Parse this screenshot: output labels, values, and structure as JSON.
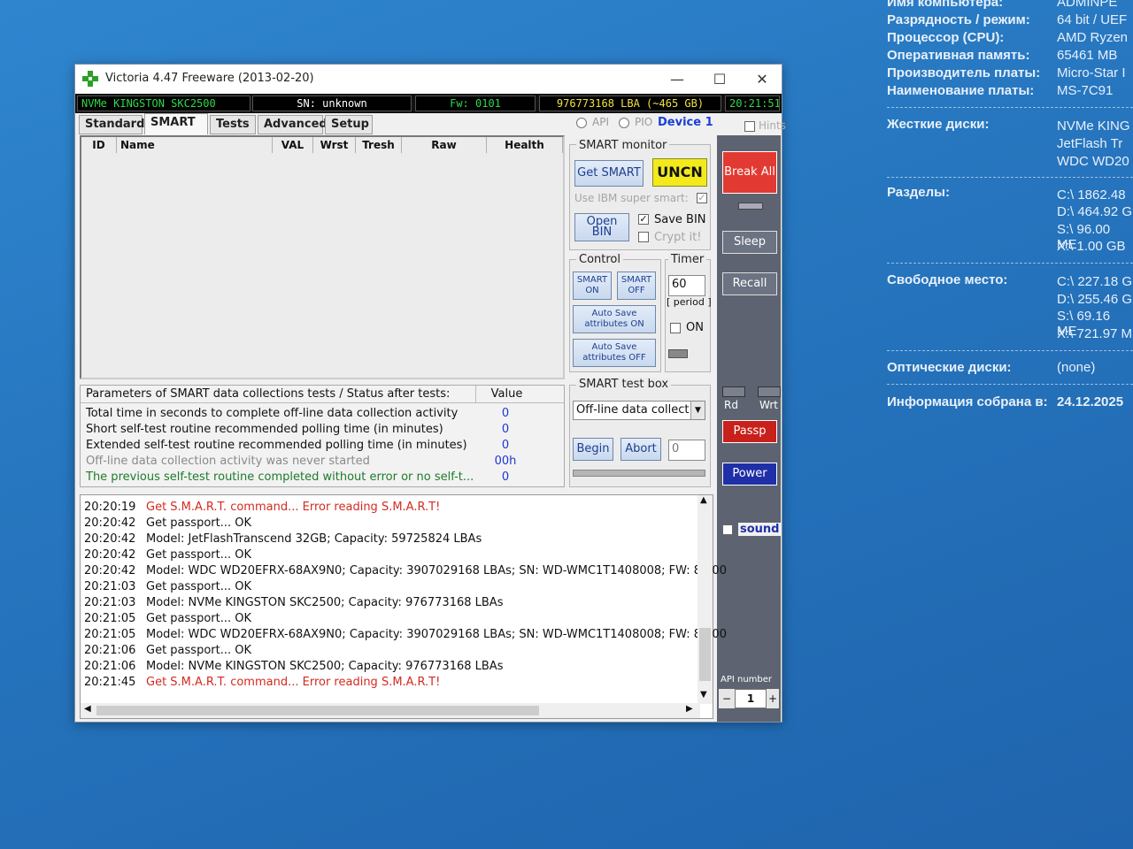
{
  "desktop_info": {
    "rows": [
      {
        "label": "Имя компьютера:",
        "value": "ADMINPE"
      },
      {
        "label": "Разрядность / режим:",
        "value": "64 bit / UEF"
      },
      {
        "label": "Процессор (CPU):",
        "value": "AMD Ryzen"
      },
      {
        "label": "Оперативная память:",
        "value": "65461 MB"
      },
      {
        "label": "Производитель платы:",
        "value": "Micro-Star I"
      },
      {
        "label": "Наименование платы:",
        "value": "MS-7C91"
      }
    ],
    "disks_label": "Жесткие диски:",
    "disks": [
      "NVMe KING",
      "JetFlash Tr",
      "WDC WD20"
    ],
    "partitions_label": "Разделы:",
    "partitions": [
      "C:\\ 1862.48",
      "D:\\ 464.92 G",
      "S:\\ 96.00 ME",
      "X:\\ 1.00 GB"
    ],
    "free_label": "Свободное место:",
    "free": [
      "C:\\ 227.18 G",
      "D:\\ 255.46 G",
      "S:\\ 69.16 ME",
      "X:\\ 721.97 M"
    ],
    "optical_label": "Оптические диски:",
    "optical_value": "(none)",
    "collected_label": "Информация собрана в:",
    "collected_value": "24.12.2025"
  },
  "window": {
    "title": "Victoria 4.47  Freeware (2013-02-20)",
    "minimize": "—",
    "maximize": "☐",
    "close": "✕"
  },
  "infobar": {
    "drive": "NVMe    KINGSTON SKC2500",
    "sn": "SN: unknown",
    "fw": "Fw: 0101",
    "lba": "976773168 LBA (~465 GB)",
    "clock": "20:21:51"
  },
  "tabs": [
    "Standard",
    "SMART",
    "Tests",
    "Advanced",
    "Setup"
  ],
  "mode": {
    "api": "API",
    "pio": "PIO",
    "device": "Device 1",
    "hints": "Hints"
  },
  "smart_table": {
    "columns": [
      "ID",
      "Name",
      "VAL",
      "Wrst",
      "Tresh",
      "Raw",
      "Health"
    ]
  },
  "params": {
    "header": "Parameters of SMART data collections tests / Status after tests:",
    "value_header": "Value",
    "rows": [
      {
        "text": "Total time in seconds to complete off-line data collection activity",
        "value": "0",
        "color": "#111111"
      },
      {
        "text": "Short self-test routine recommended polling time (in minutes)",
        "value": "0",
        "color": "#111111"
      },
      {
        "text": "Extended self-test routine recommended polling time (in minutes)",
        "value": "0",
        "color": "#111111"
      },
      {
        "text": "Off-line data collection activity was never started",
        "value": "00h",
        "color": "#8a8a8a"
      },
      {
        "text": "The previous self-test routine completed without error or no self-t...",
        "value": "0",
        "color": "#1e7b2a"
      }
    ]
  },
  "smart_monitor": {
    "label": "SMART monitor",
    "get_smart": "Get SMART",
    "status": "UNCN",
    "ibm": "Use IBM super smart:",
    "open_bin": "Open BIN",
    "save_bin": "Save BIN",
    "crypt": "Crypt it!"
  },
  "control": {
    "label": "Control",
    "smart_on": "SMART ON",
    "smart_off": "SMART OFF",
    "autosave_on": "Auto Save attributes ON",
    "autosave_off": "Auto Save attributes OFF"
  },
  "timer": {
    "label": "Timer",
    "value": "60",
    "period": "[ period ]",
    "on": "ON"
  },
  "testbox": {
    "label": "SMART test box",
    "selected": "Off-line data collect",
    "begin": "Begin",
    "abort": "Abort",
    "counter": "0"
  },
  "side": {
    "break_all": "Break All",
    "sleep": "Sleep",
    "recall": "Recall",
    "rd": "Rd",
    "wrt": "Wrt",
    "passp": "Passp",
    "power": "Power",
    "sound": "sound",
    "api_number_label": "API number",
    "api_number": "1",
    "minus": "−",
    "plus": "+"
  },
  "log": [
    {
      "time": "20:20:19",
      "msg": "Get S.M.A.R.T. command... Error reading S.M.A.R.T!",
      "color": "#d42a1f"
    },
    {
      "time": "20:20:42",
      "msg": "Get passport... OK",
      "color": "#111111"
    },
    {
      "time": "20:20:42",
      "msg": "Model: JetFlashTranscend 32GB; Capacity: 59725824 LBAs",
      "color": "#111111"
    },
    {
      "time": "20:20:42",
      "msg": "Get passport... OK",
      "color": "#111111"
    },
    {
      "time": "20:20:42",
      "msg": "Model: WDC WD20EFRX-68AX9N0; Capacity: 3907029168 LBAs; SN: WD-WMC1T1408008; FW: 80.00",
      "color": "#111111"
    },
    {
      "time": "20:21:03",
      "msg": "Get passport... OK",
      "color": "#111111"
    },
    {
      "time": "20:21:03",
      "msg": "Model: NVMe    KINGSTON SKC2500; Capacity: 976773168 LBAs",
      "color": "#111111"
    },
    {
      "time": "20:21:05",
      "msg": "Get passport... OK",
      "color": "#111111"
    },
    {
      "time": "20:21:05",
      "msg": "Model: WDC WD20EFRX-68AX9N0; Capacity: 3907029168 LBAs; SN: WD-WMC1T1408008; FW: 80.00",
      "color": "#111111"
    },
    {
      "time": "20:21:06",
      "msg": "Get passport... OK",
      "color": "#111111"
    },
    {
      "time": "20:21:06",
      "msg": "Model: NVMe    KINGSTON SKC2500; Capacity: 976773168 LBAs",
      "color": "#111111"
    },
    {
      "time": "20:21:45",
      "msg": "Get S.M.A.R.T. command... Error reading S.M.A.R.T!",
      "color": "#d42a1f"
    }
  ],
  "colors": {
    "infobar_green": "#2fd84a",
    "infobar_yellow": "#f0e040",
    "status_yellow": "#f2ea1c",
    "break_red": "#e23a32",
    "passp_red": "#c8201a",
    "power_blue": "#1f2fa8"
  }
}
